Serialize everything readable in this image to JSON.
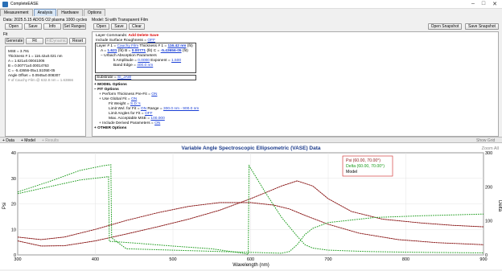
{
  "window": {
    "title": "CompleteEASE",
    "controls": [
      "–",
      "□",
      "✕"
    ]
  },
  "tabs": [
    {
      "label": "Measurement",
      "active": false
    },
    {
      "label": "Analysis",
      "active": true
    },
    {
      "label": "Hardware",
      "active": false
    },
    {
      "label": "Options",
      "active": false
    }
  ],
  "data_section": {
    "caption": "Data: 2025.5.15 ADOS O2 plasma 1000 cycles",
    "buttons": {
      "open": "Open",
      "save": "Save",
      "info": "Info",
      "set_ranges": "Set Ranges"
    }
  },
  "fit_section": {
    "caption": "Fit",
    "buttons": {
      "generate": "Generate",
      "fit": "Fit",
      "fit_dynamic": "FitDynamic",
      "reset": "Reset"
    },
    "results": [
      "MSE = 3.791",
      "Thickness # 1 = 116.42±0.021 nm",
      "A = 1.621±0.00041006",
      "B = 0.00771±0.00014763",
      "C = -5.43656-05±1.5105E-05",
      "Angle Offset = 0.0945±0.008307"
    ],
    "hint": "# of Cauchy Film @ 632.8 nm = 1.63866"
  },
  "model_section": {
    "caption": "Model: Si with Transparent Film",
    "buttons": {
      "open": "Open",
      "save": "Save",
      "clear": "Clear",
      "open_snapshot": "Open Snapshot",
      "save_snapshot": "Save Snapshot"
    },
    "layer_commands_label": "Layer Commands:",
    "layer_commands": {
      "add": "Add",
      "delete": "Delete",
      "save": "Save"
    },
    "surface_roughness": {
      "label": "Include Surface Roughness =",
      "value": "OFF"
    },
    "layer1": {
      "prefix": "Layer # 1 =",
      "name": "Cauchy Film",
      "thickness_label": "Thickness # 1 =",
      "thickness_value": "116.42 nm",
      "a_label": "A =",
      "a_value": "1.621",
      "b_label": "B =",
      "b_value": "0.00771",
      "c_label": "C =",
      "c_value": "-5.43656-05",
      "fit_flag": "(fit)",
      "urbach": {
        "caption": "Urbach Absorption Parameters",
        "k_amp_label": "k Amplitude =",
        "k_amp_value": "0.0000",
        "exponent_label": "Exponent =",
        "exponent_value": "1.500",
        "band_edge_label": "Band Edge =",
        "band_edge_value": "400.0 nm"
      }
    },
    "substrate": {
      "label": "Substrate =",
      "value": "SI_JAW"
    }
  },
  "options_tree": {
    "model_options": "MODEL Options",
    "fit_options": "FIT Options",
    "items": [
      {
        "label": "Perform Thickness Pre-Fit =",
        "value": "ON"
      },
      {
        "label": "Use Global Fit =",
        "value": "ON"
      },
      {
        "label": "Fit Weight =",
        "value": "S.D.'s"
      },
      {
        "label": "Limit Wvl. for Fit =",
        "value": "ON",
        "extra_label": "Range =",
        "extra_value": "300.0 nm - 900.0 nm"
      },
      {
        "label": "Limit Angles for Fit =",
        "value": "OFF"
      },
      {
        "label": "Max. Acceptable MSE =",
        "value": "100.000"
      },
      {
        "label": "Include Derived Parameters =",
        "value": "ON"
      }
    ],
    "other_options": "OTHER Options"
  },
  "bottom_toolbar": {
    "data": "+ Data",
    "model": "+ Model",
    "results": "+ Results",
    "show_grid": "Show Grid"
  },
  "colors": {
    "psi": "#8b1a1a",
    "delta": "#1a9a1a",
    "model": "#000000",
    "title": "#1a3a8a",
    "legend_border": "#cc2222"
  },
  "chart_data": {
    "type": "line",
    "title": "Variable Angle Spectroscopic Ellipsometric (VASE) Data",
    "zoom_label": "Zoom All",
    "xlabel": "Wavelength (nm)",
    "ylabel": "Psi",
    "y2label": "Delta",
    "xlim": [
      300,
      900
    ],
    "ylim": [
      0,
      40
    ],
    "y2lim": [
      0,
      300
    ],
    "xticks": [
      300,
      400,
      500,
      600,
      700,
      800,
      900
    ],
    "yticks": [
      0,
      10,
      20,
      30,
      40
    ],
    "y2ticks": [
      0,
      100,
      200,
      300
    ],
    "legend": [
      "Psi (60.00, 70.00°)",
      "Delta (60.00, 70.00°)",
      "Model"
    ],
    "legend_position": "top-right",
    "series": [
      {
        "name": "Psi (60.00, 70.00°)",
        "axis": "left",
        "x": [
          300,
          330,
          360,
          400,
          440,
          480,
          520,
          560,
          600,
          640,
          660,
          680,
          700,
          730,
          770,
          820,
          860,
          900
        ],
        "y": [
          5.5,
          3.5,
          3.6,
          5.5,
          8.2,
          11,
          14,
          17.5,
          22,
          27,
          29,
          27,
          22,
          17,
          14,
          12.5,
          11.6,
          11
        ]
      },
      {
        "name": "Psi (60.00, 70.00°) 70°",
        "axis": "left",
        "x": [
          300,
          330,
          360,
          400,
          440,
          480,
          520,
          560,
          600,
          630,
          650,
          670,
          700,
          740,
          790,
          840,
          900
        ],
        "y": [
          7,
          6,
          7,
          10,
          13.5,
          16.5,
          19,
          20.5,
          20.5,
          19.5,
          18,
          15.5,
          12,
          8.5,
          6,
          4.8,
          4
        ]
      },
      {
        "name": "Delta (60.00, 70.00°)",
        "axis": "right",
        "x": [
          300,
          340,
          380,
          410,
          417,
          418,
          450,
          500,
          550,
          590,
          597,
          598,
          620,
          640,
          660,
          670,
          680,
          700,
          750,
          800,
          850,
          900
        ],
        "y": [
          180,
          200,
          220,
          228,
          230,
          40,
          35,
          26,
          18,
          5,
          2,
          262,
          180,
          110,
          55,
          30,
          20,
          14,
          10,
          8,
          7,
          6
        ]
      },
      {
        "name": "Delta (60.00, 70.00°) 70°",
        "axis": "right",
        "x": [
          300,
          340,
          380,
          410,
          420,
          421,
          440,
          500,
          560,
          640,
          650,
          660,
          670,
          680,
          700,
          760,
          820,
          900
        ],
        "y": [
          185,
          215,
          248,
          262,
          265,
          50,
          18,
          14,
          10,
          5,
          10,
          30,
          60,
          78,
          95,
          110,
          115,
          120
        ]
      }
    ]
  }
}
